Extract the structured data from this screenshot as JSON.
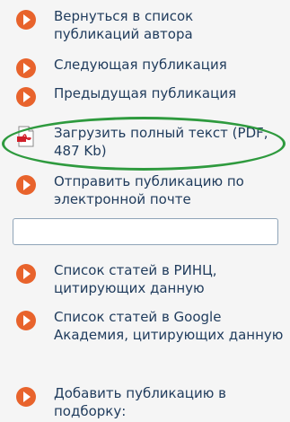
{
  "menu": {
    "back_to_author": {
      "line1": "Вернуться в список",
      "line2": "публикаций автора"
    },
    "next_publication": "Следующая публикация",
    "prev_publication": "Предыдущая публикация",
    "download_full_text": {
      "line1": "Загрузить полный текст (PDF,",
      "line2": "487 Kb)"
    },
    "send_by_email": {
      "line1": "Отправить публикацию по",
      "line2": "электронной почте"
    },
    "email_input": {
      "value": "",
      "placeholder": ""
    },
    "rinc_citing": {
      "line1": "Список статей в РИНЦ,",
      "line2": "цитирующих данную"
    },
    "google_citing": {
      "line1": "Список статей в Google",
      "line2": "Академия, цитирующих данную"
    },
    "add_to_collection": {
      "line1": "Добавить публикацию в",
      "line2": "подборку:"
    }
  },
  "colors": {
    "bullet": "#e8632c",
    "highlight": "#2e9a3e",
    "link_text": "#1f3b5c"
  },
  "icons": {
    "bullet": "orange-play-bullet-icon",
    "download": "pdf-file-icon"
  }
}
